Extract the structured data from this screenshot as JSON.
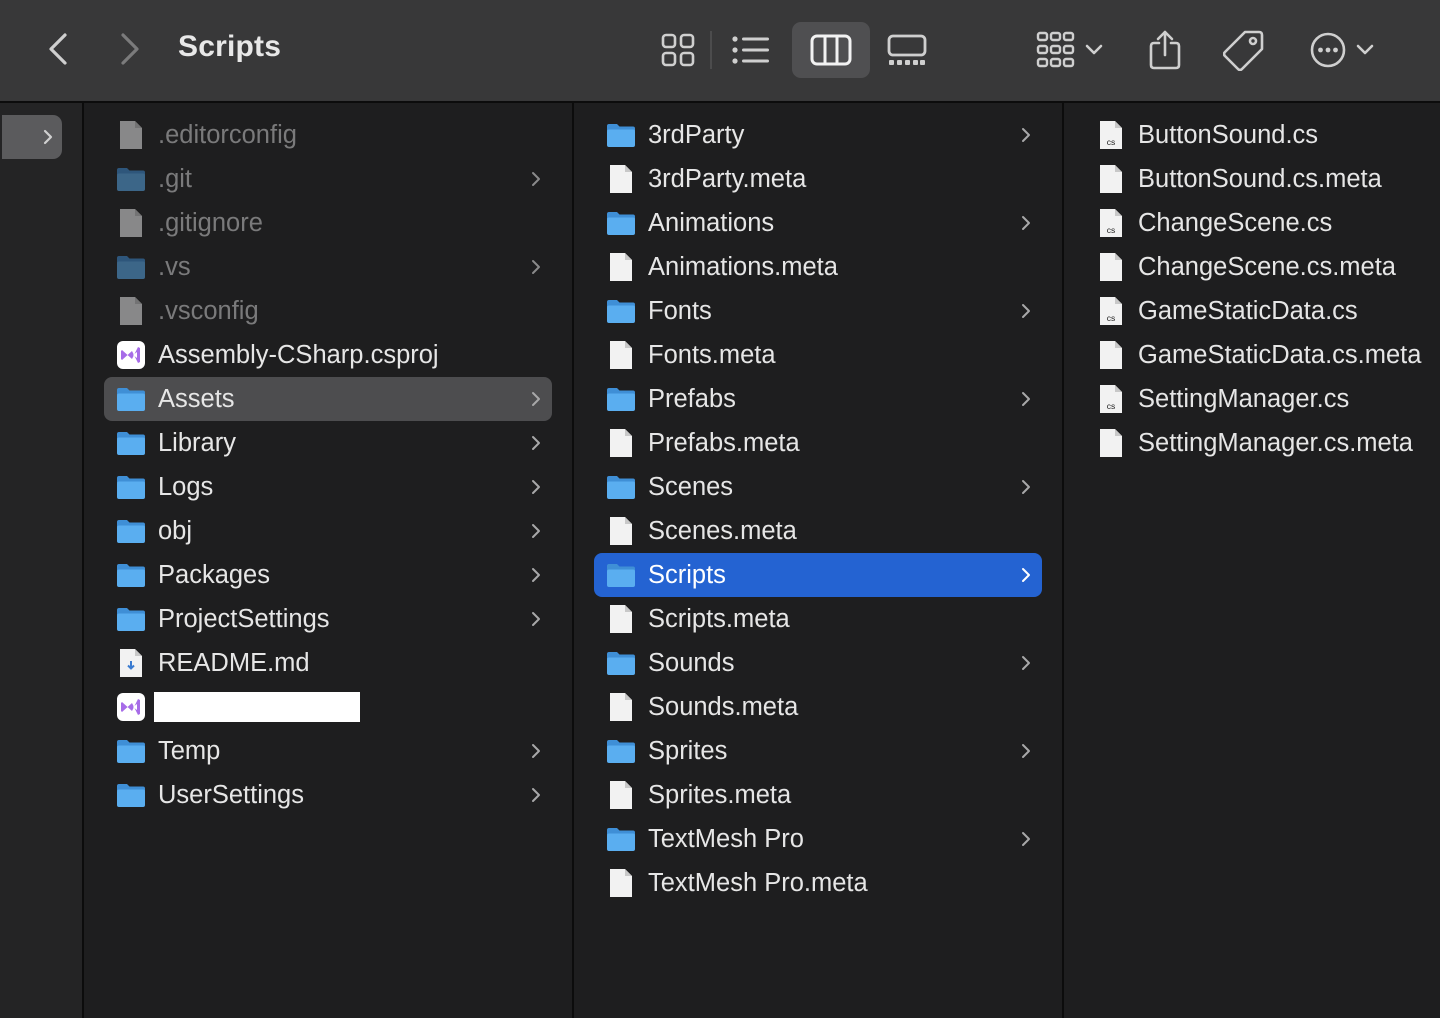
{
  "window": {
    "title": "Scripts"
  },
  "toolbar": {
    "back_icon": "chevron-left-icon",
    "forward_icon": "chevron-right-icon",
    "views": [
      "icon-view",
      "list-view",
      "column-view",
      "gallery-view"
    ],
    "active_view": "column-view",
    "group_icon": "group-icon",
    "share_icon": "share-icon",
    "tag_icon": "tag-icon",
    "more_icon": "ellipsis-circle-icon"
  },
  "colors": {
    "selection_active": "#2463d2",
    "selection_inactive": "#4d4d4f",
    "folder": "#5aaef0",
    "vs_icon": "#a76ce8"
  },
  "columns": [
    {
      "items": [
        {
          "name": ".editorconfig",
          "kind": "file",
          "hidden": true
        },
        {
          "name": ".git",
          "kind": "folder",
          "hidden": true,
          "chevron": true
        },
        {
          "name": ".gitignore",
          "kind": "file",
          "hidden": true
        },
        {
          "name": ".vs",
          "kind": "folder",
          "hidden": true,
          "chevron": true
        },
        {
          "name": ".vsconfig",
          "kind": "file",
          "hidden": true
        },
        {
          "name": "Assembly-CSharp.csproj",
          "kind": "vs"
        },
        {
          "name": "Assets",
          "kind": "folder",
          "chevron": true,
          "selected": "inactive"
        },
        {
          "name": "Library",
          "kind": "folder",
          "chevron": true
        },
        {
          "name": "Logs",
          "kind": "folder",
          "chevron": true
        },
        {
          "name": "obj",
          "kind": "folder",
          "chevron": true
        },
        {
          "name": "Packages",
          "kind": "folder",
          "chevron": true
        },
        {
          "name": "ProjectSettings",
          "kind": "folder",
          "chevron": true
        },
        {
          "name": "README.md",
          "kind": "md"
        },
        {
          "name": "",
          "kind": "vs",
          "redacted": true
        },
        {
          "name": "Temp",
          "kind": "folder",
          "chevron": true
        },
        {
          "name": "UserSettings",
          "kind": "folder",
          "chevron": true
        }
      ]
    },
    {
      "items": [
        {
          "name": "3rdParty",
          "kind": "folder",
          "chevron": true
        },
        {
          "name": "3rdParty.meta",
          "kind": "file"
        },
        {
          "name": "Animations",
          "kind": "folder",
          "chevron": true
        },
        {
          "name": "Animations.meta",
          "kind": "file"
        },
        {
          "name": "Fonts",
          "kind": "folder",
          "chevron": true
        },
        {
          "name": "Fonts.meta",
          "kind": "file"
        },
        {
          "name": "Prefabs",
          "kind": "folder",
          "chevron": true
        },
        {
          "name": "Prefabs.meta",
          "kind": "file"
        },
        {
          "name": "Scenes",
          "kind": "folder",
          "chevron": true
        },
        {
          "name": "Scenes.meta",
          "kind": "file"
        },
        {
          "name": "Scripts",
          "kind": "folder",
          "chevron": true,
          "selected": "active"
        },
        {
          "name": "Scripts.meta",
          "kind": "file"
        },
        {
          "name": "Sounds",
          "kind": "folder",
          "chevron": true
        },
        {
          "name": "Sounds.meta",
          "kind": "file"
        },
        {
          "name": "Sprites",
          "kind": "folder",
          "chevron": true
        },
        {
          "name": "Sprites.meta",
          "kind": "file"
        },
        {
          "name": "TextMesh Pro",
          "kind": "folder",
          "chevron": true
        },
        {
          "name": "TextMesh Pro.meta",
          "kind": "file"
        }
      ]
    },
    {
      "items": [
        {
          "name": "ButtonSound.cs",
          "kind": "cs"
        },
        {
          "name": "ButtonSound.cs.meta",
          "kind": "file"
        },
        {
          "name": "ChangeScene.cs",
          "kind": "cs"
        },
        {
          "name": "ChangeScene.cs.meta",
          "kind": "file"
        },
        {
          "name": "GameStaticData.cs",
          "kind": "cs"
        },
        {
          "name": "GameStaticData.cs.meta",
          "kind": "file"
        },
        {
          "name": "SettingManager.cs",
          "kind": "cs"
        },
        {
          "name": "SettingManager.cs.meta",
          "kind": "file"
        }
      ]
    }
  ],
  "file_badges": {
    "cs": "cs"
  }
}
